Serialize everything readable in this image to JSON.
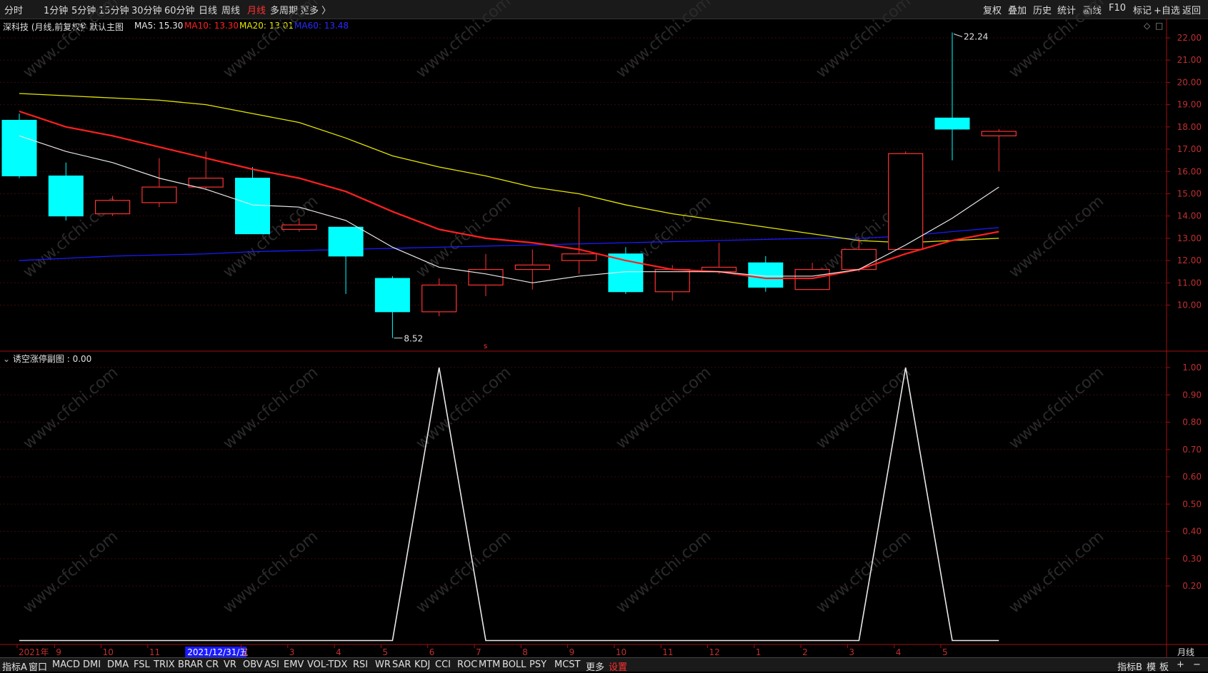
{
  "topbar": {
    "left_items": [
      "分时",
      "1分钟",
      "5分钟",
      "15分钟",
      "30分钟",
      "60分钟",
      "日线",
      "周线",
      "月线",
      "多周期",
      "更多 〉"
    ],
    "active_index": 8,
    "right_items": [
      "复权",
      "叠加",
      "历史",
      "统计",
      "画线",
      "F10",
      "标记",
      "+自选",
      "返回"
    ]
  },
  "info": {
    "stock": "深科技 (月线,前复权)",
    "main_chart": "默认主图",
    "ma5": "MA5: 15.30",
    "ma10": "MA10: 13.30",
    "ma20": "MA20: 13.01",
    "ma60": "MA60: 13.48"
  },
  "sub_info": "诱空涨停副图 : 0.00",
  "xaxis": {
    "labels": [
      "2021年",
      "9",
      "10",
      "11",
      "2021/12/31/五",
      "2",
      "3",
      "4",
      "5",
      "6",
      "7",
      "8",
      "9",
      "10",
      "11",
      "12",
      "1",
      "2",
      "3",
      "4",
      "5"
    ],
    "period_label": "月线"
  },
  "bottombar": {
    "tabs": [
      "指标A",
      "窗口",
      "MACD",
      "DMI",
      "DMA",
      "FSL",
      "TRIX",
      "BRAR",
      "CR",
      "VR",
      "OBV",
      "ASI",
      "EMV",
      "VOL-TDX",
      "RSI",
      "WR",
      "SAR",
      "KDJ",
      "CCI",
      "ROC",
      "MTM",
      "BOLL",
      "PSY",
      "MCST",
      "更多",
      "设置"
    ],
    "right_tabs": [
      "指标B",
      "模",
      "板",
      "+",
      "−"
    ]
  },
  "watermark": "www.cfchi.com",
  "colors": {
    "up": "#ff3232",
    "down": "#00ffff",
    "ma5": "#e8e8e8",
    "ma10": "#ff2020",
    "ma20": "#e6e600",
    "ma60": "#1a1aff",
    "axis": "#a01010"
  },
  "chart_data": [
    {
      "type": "candlestick",
      "x": [
        "2021-08",
        "2021-09",
        "2021-10",
        "2021-11",
        "2021-12",
        "2022-01",
        "2022-02",
        "2022-03",
        "2022-04",
        "2022-05",
        "2022-06",
        "2022-07",
        "2022-08",
        "2022-09",
        "2022-10",
        "2022-11",
        "2022-12",
        "2023-01",
        "2023-02",
        "2023-03",
        "2023-04",
        "2023-05"
      ],
      "ohlc": [
        [
          18.3,
          18.6,
          15.7,
          15.8
        ],
        [
          15.8,
          16.4,
          13.8,
          14.0
        ],
        [
          14.1,
          14.9,
          14.0,
          14.7
        ],
        [
          14.6,
          16.6,
          14.4,
          15.3
        ],
        [
          15.3,
          16.9,
          15.2,
          15.7
        ],
        [
          15.7,
          16.2,
          13.2,
          13.2
        ],
        [
          13.4,
          13.9,
          13.3,
          13.6
        ],
        [
          13.5,
          13.5,
          10.5,
          12.2
        ],
        [
          11.2,
          11.3,
          8.52,
          9.7
        ],
        [
          9.7,
          11.2,
          9.5,
          10.9
        ],
        [
          10.9,
          12.3,
          10.4,
          11.6
        ],
        [
          11.6,
          12.5,
          10.7,
          11.8
        ],
        [
          12.0,
          14.4,
          11.4,
          12.3
        ],
        [
          12.3,
          12.6,
          10.5,
          10.6
        ],
        [
          10.6,
          11.8,
          10.2,
          11.6
        ],
        [
          11.5,
          12.8,
          11.4,
          11.7
        ],
        [
          11.9,
          12.2,
          10.6,
          10.8
        ],
        [
          10.7,
          11.9,
          10.7,
          11.6
        ],
        [
          11.6,
          13.0,
          11.5,
          12.5
        ],
        [
          12.5,
          16.9,
          12.5,
          16.8
        ],
        [
          18.4,
          22.24,
          16.5,
          17.9
        ],
        [
          17.6,
          17.9,
          16.0,
          17.8
        ]
      ],
      "ma5": [
        17.6,
        16.9,
        16.4,
        15.7,
        15.2,
        14.5,
        14.4,
        13.8,
        12.6,
        11.7,
        11.4,
        11.0,
        11.3,
        11.5,
        11.5,
        11.5,
        11.3,
        11.3,
        11.6,
        12.7,
        13.9,
        15.3
      ],
      "ma10": [
        18.7,
        18.0,
        17.6,
        17.1,
        16.6,
        16.1,
        15.7,
        15.1,
        14.2,
        13.4,
        13.0,
        12.8,
        12.5,
        12.0,
        11.6,
        11.5,
        11.2,
        11.2,
        11.6,
        12.3,
        12.9,
        13.3
      ],
      "ma20": [
        19.5,
        19.4,
        19.3,
        19.2,
        19.0,
        18.6,
        18.2,
        17.5,
        16.7,
        16.2,
        15.8,
        15.3,
        15.0,
        14.5,
        14.1,
        13.8,
        13.5,
        13.2,
        12.9,
        12.8,
        12.9,
        13.0
      ],
      "ma60": [
        12.0,
        12.1,
        12.2,
        12.25,
        12.3,
        12.4,
        12.45,
        12.5,
        12.55,
        12.6,
        12.65,
        12.7,
        12.75,
        12.8,
        12.85,
        12.9,
        12.95,
        13.0,
        13.0,
        13.1,
        13.3,
        13.48
      ],
      "annotations": {
        "high": "22.24",
        "low": "8.52"
      },
      "ylim": [
        8.3,
        22.9
      ],
      "yticks": [
        "10.00",
        "11.00",
        "12.00",
        "13.00",
        "14.00",
        "15.00",
        "16.00",
        "17.00",
        "18.00",
        "19.00",
        "20.00",
        "21.00",
        "22.00"
      ]
    },
    {
      "type": "line",
      "name": "诱空涨停副图",
      "values": [
        0,
        0,
        0,
        0,
        0,
        0,
        0,
        0,
        0,
        1,
        0,
        0,
        0,
        0,
        0,
        0,
        0,
        0,
        0,
        1,
        0,
        0
      ],
      "ylim": [
        0,
        1.05
      ],
      "yticks": [
        "0.20",
        "0.30",
        "0.40",
        "0.50",
        "0.60",
        "0.70",
        "0.80",
        "0.90",
        "1.00"
      ]
    }
  ]
}
